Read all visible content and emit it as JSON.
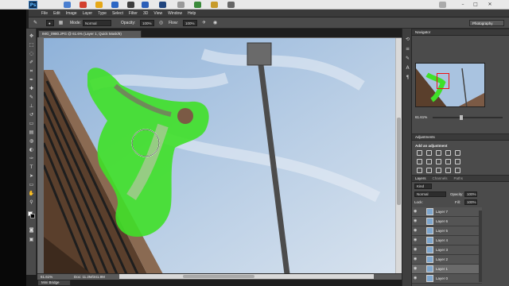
{
  "app": {
    "logo": "Ps"
  },
  "menu": [
    "File",
    "Edit",
    "Image",
    "Layer",
    "Type",
    "Select",
    "Filter",
    "3D",
    "View",
    "Window",
    "Help"
  ],
  "options": {
    "mode_label": "Mode:",
    "mode_value": "Normal",
    "opacity_label": "Opacity:",
    "opacity_value": "100%",
    "flow_label": "Flow:",
    "flow_value": "100%",
    "workspace": "Photography"
  },
  "document": {
    "tab_title": "IMG_0980.JPG @ 61.6% (Layer 1, Quick Mask/8)",
    "zoom": "61.61%",
    "doc_size": "Doc: 11.2M/341.9M"
  },
  "mini_bridge": "Mini Bridge",
  "navigator": {
    "title": "Navigator",
    "zoom": "61.61%"
  },
  "adjustments": {
    "title": "Adjustments",
    "subtitle": "Add an adjustment"
  },
  "layers_panel": {
    "tabs": [
      "Layers",
      "Channels",
      "Paths"
    ],
    "kind_label": "Kind",
    "blend_mode": "Normal",
    "opacity_label": "Opacity:",
    "opacity_value": "100%",
    "lock_label": "Lock:",
    "fill_label": "Fill:",
    "fill_value": "100%",
    "layers": [
      "Layer 7",
      "Layer 6",
      "Layer 5",
      "Layer 4",
      "Layer 3",
      "Layer 2",
      "Layer 1",
      "Layer 0"
    ]
  },
  "colors": {
    "quick_mask": "#3fe028",
    "sky": "#a9c3e0",
    "panel": "#4b4b4b"
  }
}
